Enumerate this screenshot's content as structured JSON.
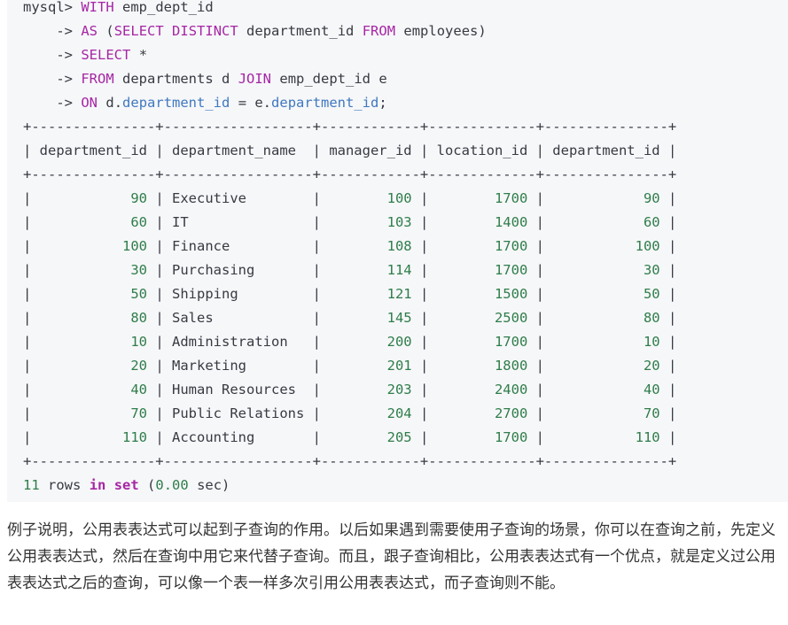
{
  "query": {
    "prompt": "mysql>",
    "cont": "->",
    "l1": {
      "kw": "WITH",
      "name": "emp_dept_id"
    },
    "l2": {
      "kw1": "AS",
      "paren": "(",
      "kw2": "SELECT",
      "kw3": "DISTINCT",
      "col": "department_id",
      "kw4": "FROM",
      "tbl": "employees)"
    },
    "l3": {
      "kw": "SELECT",
      "star": "*"
    },
    "l4": {
      "kw1": "FROM",
      "tbl": "departments d",
      "kw2": "JOIN",
      "rest": "emp_dept_id e"
    },
    "l5": {
      "kw": "ON",
      "a": "d.",
      "col1": "department_id",
      "eq": " = e.",
      "col2": "department_id",
      "semi": ";"
    }
  },
  "result": {
    "border": "+---------------+------------------+------------+-------------+---------------+",
    "columns": [
      "department_id",
      "department_name",
      "manager_id",
      "location_id",
      "department_id"
    ],
    "rows": [
      [
        "90",
        "Executive",
        "100",
        "1700",
        "90"
      ],
      [
        "60",
        "IT",
        "103",
        "1400",
        "60"
      ],
      [
        "100",
        "Finance",
        "108",
        "1700",
        "100"
      ],
      [
        "30",
        "Purchasing",
        "114",
        "1700",
        "30"
      ],
      [
        "50",
        "Shipping",
        "121",
        "1500",
        "50"
      ],
      [
        "80",
        "Sales",
        "145",
        "2500",
        "80"
      ],
      [
        "10",
        "Administration",
        "200",
        "1700",
        "10"
      ],
      [
        "20",
        "Marketing",
        "201",
        "1800",
        "20"
      ],
      [
        "40",
        "Human Resources",
        "203",
        "2400",
        "40"
      ],
      [
        "70",
        "Public Relations",
        "204",
        "2700",
        "70"
      ],
      [
        "110",
        "Accounting",
        "205",
        "1700",
        "110"
      ]
    ],
    "summary": {
      "count": "11",
      "rows_word": "rows",
      "in_kw": "in",
      "set_kw": "set",
      "time_open": "(",
      "time": "0.00",
      "time_close": "sec)"
    }
  },
  "paragraph": "例子说明，公用表表达式可以起到子查询的作用。以后如果遇到需要使用子查询的场景，你可以在查询之前，先定义公用表表达式，然后在查询中用它来代替子查询。而且，跟子查询相比，公用表表达式有一个优点，就是定义过公用表表达式之后的查询，可以像一个表一样多次引用公用表表达式，而子查询则不能。"
}
